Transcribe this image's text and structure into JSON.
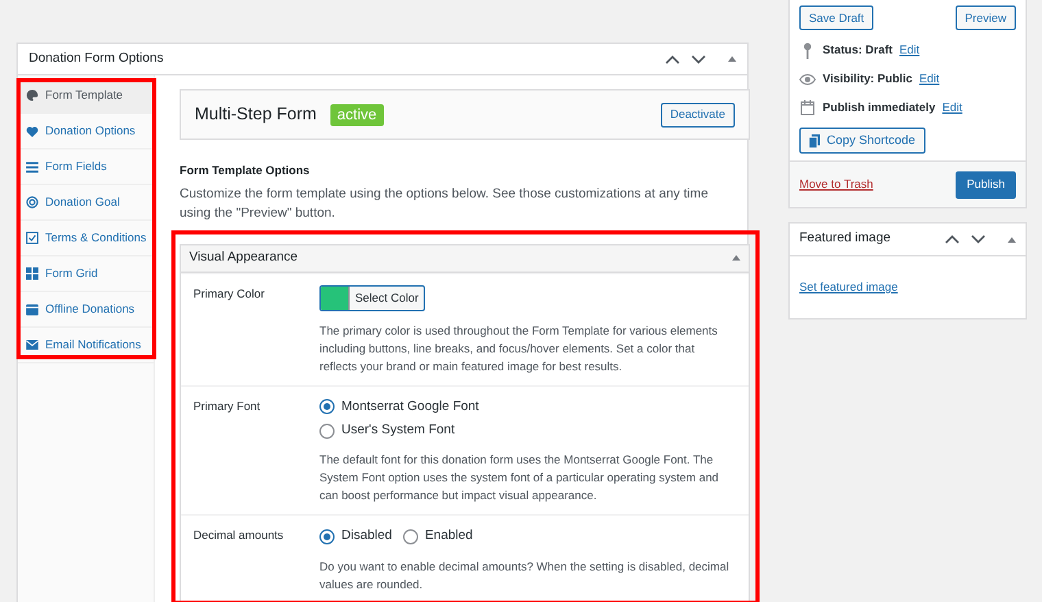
{
  "metabox": {
    "title": "Donation Form Options",
    "nav": [
      {
        "label": "Form Template",
        "selected": true
      },
      {
        "label": "Donation Options",
        "selected": false
      },
      {
        "label": "Form Fields",
        "selected": false
      },
      {
        "label": "Donation Goal",
        "selected": false
      },
      {
        "label": "Terms & Conditions",
        "selected": false
      },
      {
        "label": "Form Grid",
        "selected": false
      },
      {
        "label": "Offline Donations",
        "selected": false
      },
      {
        "label": "Email Notifications",
        "selected": false
      }
    ],
    "template": {
      "name": "Multi-Step Form",
      "badge": "active",
      "button": "Deactivate"
    },
    "options_title": "Form Template Options",
    "options_description": "Customize the form template using the options below. See those customizations at any time using the \"Preview\" button.",
    "section": {
      "title": "Visual Appearance",
      "expanded": true,
      "rows": [
        {
          "kind": "color",
          "label": "Primary Color",
          "color": "#26c279",
          "button": "Select Color",
          "help": "The primary color is used throughout the Form Template for various elements including buttons, line breaks, and focus/hover elements. Set a color that reflects your brand or main featured image for best results."
        },
        {
          "kind": "radio-stack",
          "label": "Primary Font",
          "options": [
            {
              "label": "Montserrat Google Font",
              "selected": true
            },
            {
              "label": "User's System Font",
              "selected": false
            }
          ],
          "help": "The default font for this donation form uses the Montserrat Google Font. The System Font option uses the system font of a particular operating system and can boost performance but impact visual appearance."
        },
        {
          "kind": "radio-inline",
          "label": "Decimal amounts",
          "options": [
            {
              "label": "Disabled",
              "selected": true
            },
            {
              "label": "Enabled",
              "selected": false
            }
          ],
          "help": "Do you want to enable decimal amounts? When the setting is disabled, decimal values are rounded."
        }
      ]
    }
  },
  "publish": {
    "save_draft": "Save Draft",
    "preview": "Preview",
    "meta": [
      {
        "kind": "status",
        "text": "Status: Draft",
        "link": "Edit"
      },
      {
        "kind": "visibility",
        "text": "Visibility: Public",
        "link": "Edit"
      },
      {
        "kind": "schedule",
        "text": "Publish immediately",
        "link": "Edit"
      }
    ],
    "copy_shortcode": "Copy Shortcode",
    "trash": "Move to Trash",
    "publish": "Publish"
  },
  "featured_image": {
    "title": "Featured image",
    "link": "Set featured image"
  }
}
